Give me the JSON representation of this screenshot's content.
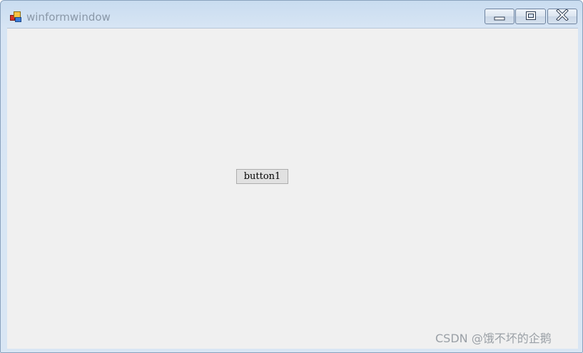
{
  "window": {
    "title": "winformwindow",
    "app_icon": "winforms-app-icon"
  },
  "caption_buttons": {
    "minimize": "minimize-icon",
    "maximize": "maximize-icon",
    "close": "close-icon"
  },
  "form": {
    "button1_label": "button1"
  },
  "watermark": {
    "text": "CSDN @饿不坏的企鹅"
  },
  "colors": {
    "client_background": "#f0f0f0",
    "titlebar": "#c9dcf0",
    "button_face": "#e1e1e1"
  }
}
